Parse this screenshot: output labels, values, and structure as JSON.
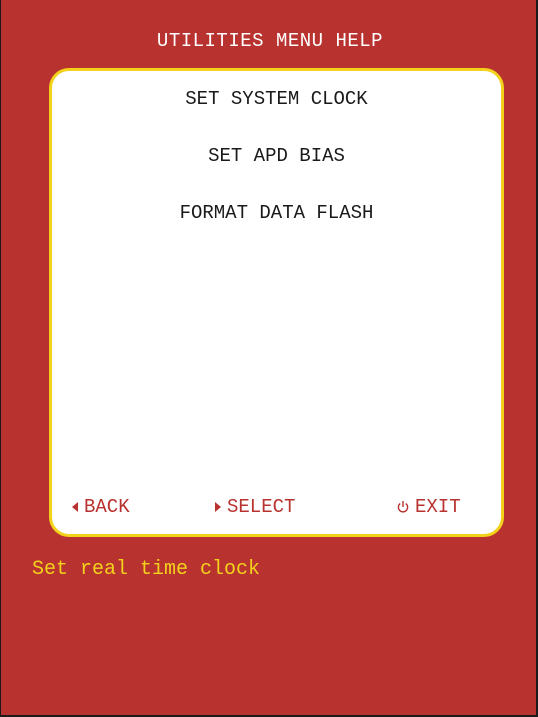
{
  "screen": {
    "title": "UTILITIES MENU HELP",
    "background_color": "#b8322f",
    "accent_color": "#f3d21b"
  },
  "menu": {
    "items": [
      {
        "label": "SET SYSTEM CLOCK"
      },
      {
        "label": "SET APD BIAS"
      },
      {
        "label": "FORMAT DATA FLASH"
      }
    ]
  },
  "footer": {
    "back_label": "BACK",
    "back_icon": "triangle-left-icon",
    "select_label": "SELECT",
    "select_icon": "triangle-right-icon",
    "exit_label": "EXIT",
    "exit_icon": "power-icon"
  },
  "status": {
    "help_text": "Set real time clock"
  }
}
